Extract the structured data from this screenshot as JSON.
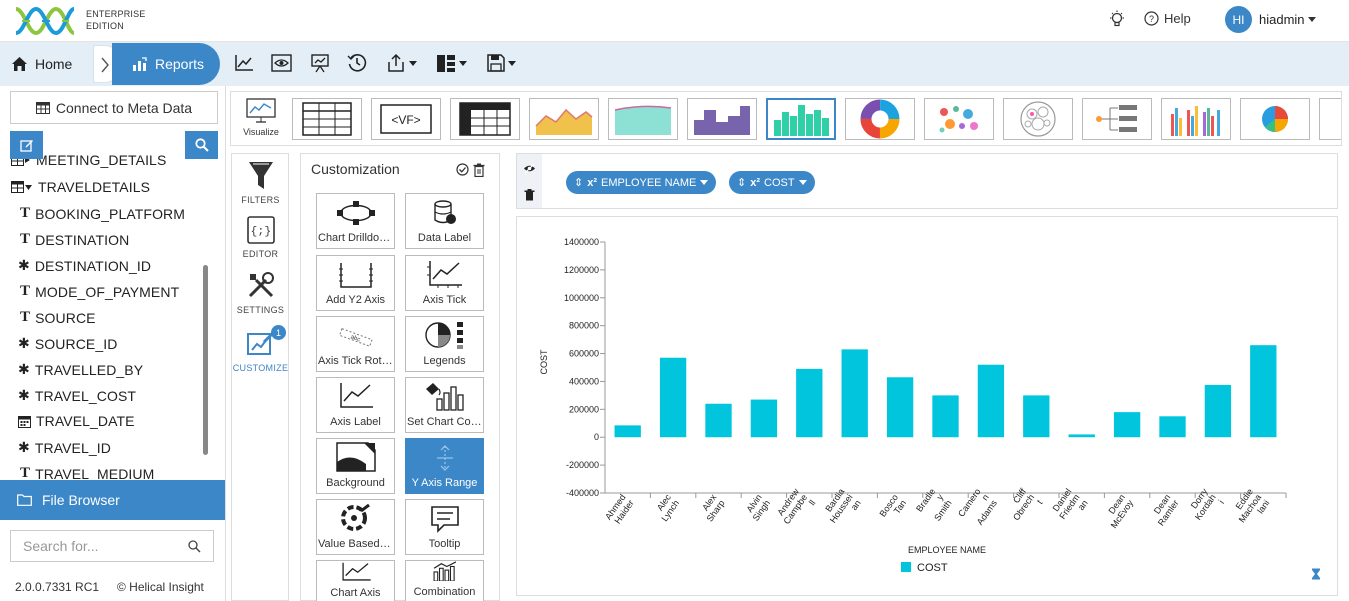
{
  "header": {
    "edition_line1": "ENTERPRISE",
    "edition_line2": "EDITION",
    "help_label": "Help",
    "avatar_initials": "HI",
    "username": "hiadmin"
  },
  "nav": {
    "home_label": "Home",
    "reports_label": "Reports",
    "toolbar_icons": [
      "line-chart-icon",
      "preview-eye-icon",
      "presentation-icon",
      "history-icon",
      "export-icon",
      "layout-icon",
      "save-icon"
    ]
  },
  "left_panel": {
    "connect_label": "Connect to Meta Data",
    "tree_items": [
      {
        "label": "MEETING_DETAILS",
        "type": "table-collapsed"
      },
      {
        "label": "TRAVELDETAILS",
        "type": "table-expanded"
      },
      {
        "label": "BOOKING_PLATFORM",
        "type": "text"
      },
      {
        "label": "DESTINATION",
        "type": "text"
      },
      {
        "label": "DESTINATION_ID",
        "type": "numeric"
      },
      {
        "label": "MODE_OF_PAYMENT",
        "type": "text"
      },
      {
        "label": "SOURCE",
        "type": "text"
      },
      {
        "label": "SOURCE_ID",
        "type": "numeric"
      },
      {
        "label": "TRAVELLED_BY",
        "type": "numeric"
      },
      {
        "label": "TRAVEL_COST",
        "type": "numeric"
      },
      {
        "label": "TRAVEL_DATE",
        "type": "date"
      },
      {
        "label": "TRAVEL_ID",
        "type": "numeric"
      },
      {
        "label": "TRAVEL_MEDIUM",
        "type": "text"
      }
    ],
    "file_browser_label": "File Browser",
    "search_placeholder": "Search for...",
    "version": "2.0.0.7331 RC1",
    "copyright": "© Helical Insight"
  },
  "viz": {
    "visualize_label": "Visualize",
    "selected_index": 7
  },
  "side_tabs": [
    "FILTERS",
    "EDITOR",
    "SETTINGS",
    "CUSTOMIZE"
  ],
  "customize_badge": "1",
  "customization": {
    "title": "Customization",
    "options": [
      "Chart Drilldown",
      "Data Label",
      "Add Y2 Axis",
      "Axis Tick",
      "Axis Tick Rotation",
      "Legends",
      "Axis Label",
      "Set Chart Colors",
      "Background",
      "Y Axis Range",
      "Value Based Colors",
      "Tooltip",
      "Chart Axis",
      "Combination"
    ],
    "selected": "Y Axis Range"
  },
  "fields": {
    "dimension": "EMPLOYEE NAME",
    "measure": "COST",
    "pill_prefix": "x²"
  },
  "chart_data": {
    "type": "bar",
    "xlabel": "EMPLOYEE NAME",
    "ylabel": "COST",
    "ylim": [
      -400000,
      1400000
    ],
    "ytick_step": 200000,
    "yticks": [
      "1400000",
      "1200000",
      "1000000",
      "800000",
      "600000",
      "400000",
      "200000",
      "0",
      "-200000",
      "-400000"
    ],
    "color": "#00c5dc",
    "legend": "COST",
    "legend_placement": "bottom",
    "categories": [
      "Ahmed Haider",
      "Alec Lynch",
      "Alex Sharp",
      "Alvin Singh",
      "Andrew Campbell",
      "Bardia Housseinian",
      "Bosco Tan",
      "Bradley Smith",
      "Cameron Adams",
      "Cliff Obrecht",
      "Daniel Friedman",
      "Dean McEvoy",
      "Dean Ramler",
      "Dorry Kordahi",
      "Eddie Machoalani"
    ],
    "tick_label_lines": [
      [
        "Ahmed",
        "Haider"
      ],
      [
        "Alec",
        "Lynch"
      ],
      [
        "Alex",
        "Sharp"
      ],
      [
        "Alvin",
        "Singh"
      ],
      [
        "Andrew",
        "Campbe",
        "ll"
      ],
      [
        "Bardia",
        "Houssei",
        "an"
      ],
      [
        "Bosco",
        "Tan"
      ],
      [
        "Bradle",
        "y",
        "Smith"
      ],
      [
        "Camero",
        "n",
        "Adams"
      ],
      [
        "Cliff",
        "Obrech",
        "t"
      ],
      [
        "Daniel",
        "Friedm",
        "an"
      ],
      [
        "Dean",
        "McEvoy"
      ],
      [
        "Dean",
        "Ramler"
      ],
      [
        "Dorry",
        "Kordah",
        "i"
      ],
      [
        "Eddie",
        "Machoa",
        "lani"
      ]
    ],
    "values": [
      85000,
      570000,
      240000,
      270000,
      490000,
      630000,
      430000,
      300000,
      520000,
      300000,
      20000,
      180000,
      150000,
      375000,
      660000
    ]
  }
}
